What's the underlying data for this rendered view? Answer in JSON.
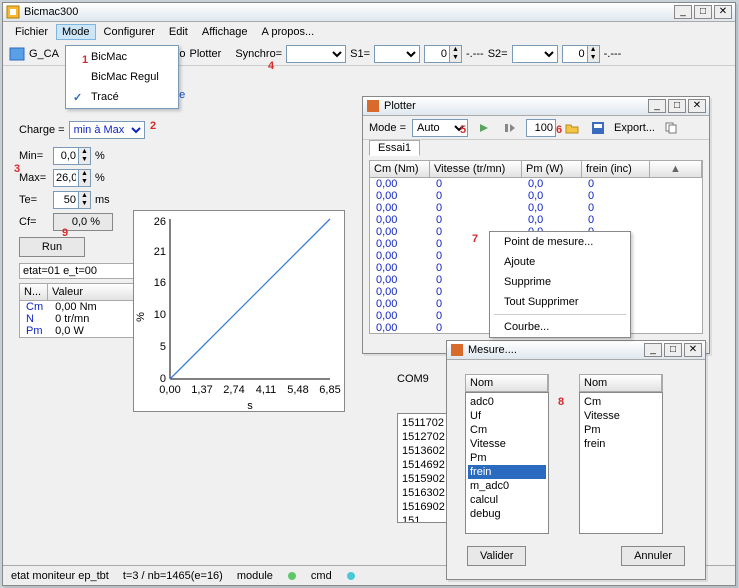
{
  "main_window": {
    "title": "Bicmac300",
    "menus": [
      "Fichier",
      "Mode",
      "Configurer",
      "Edit",
      "Affichage",
      "A propos..."
    ],
    "mode_submenu": {
      "items": [
        "BicMac",
        "BicMac Regul",
        "Tracé"
      ],
      "checked_index": 2
    },
    "toolbar": {
      "gca_prefix": "G_CA",
      "plotter_label": "Plotter",
      "synchro_label": "Synchro=",
      "s1_label": "S1=",
      "s2_label": "S2=",
      "spin_zero": "0",
      "link_ue": "ue"
    },
    "left_panel": {
      "charge_label": "Charge =",
      "charge_value": "min à Max",
      "min_label": "Min=",
      "min_value": "0,0",
      "pct": "%",
      "max_label": "Max=",
      "max_value": "26,0",
      "te_label": "Te=",
      "te_value": "50",
      "te_unit": "ms",
      "cf_label": "Cf=",
      "cf_value": "0,0 %",
      "run_label": "Run",
      "etat": "etat=01 e_t=00",
      "table_header_n": "N...",
      "table_header_val": "Valeur",
      "rows": [
        [
          "Cm",
          "0,00 Nm"
        ],
        [
          "N",
          "0 tr/mn"
        ],
        [
          "Pm",
          "0,0  W"
        ]
      ]
    }
  },
  "chart_data": {
    "type": "line",
    "title": "",
    "xlabel": "s",
    "ylabel": "%",
    "x": [
      0.0,
      6.85
    ],
    "values": [
      0,
      26
    ],
    "xticks": [
      "0,00",
      "1,37",
      "2,74",
      "4,11",
      "5,48",
      "6,85"
    ],
    "yticks": [
      "0",
      "5",
      "10",
      "16",
      "21",
      "26"
    ],
    "xlim": [
      0,
      6.85
    ],
    "ylim": [
      0,
      26
    ]
  },
  "plotter_window": {
    "title": "Plotter",
    "mode_label": "Mode =",
    "mode_value": "Auto",
    "hundred": "100",
    "export_label": "Export...",
    "tab": "Essai1",
    "columns": [
      "Cm (Nm)",
      "Vitesse (tr/mn)",
      "Pm (W)",
      "frein (inc)"
    ],
    "row": [
      "0,00",
      "0",
      "0,0",
      "0"
    ],
    "row_count": 13,
    "context_menu": [
      "Point de mesure...",
      "Ajoute",
      "Supprime",
      "Tout Supprimer",
      "Courbe..."
    ]
  },
  "mesure_window": {
    "title": "Mesure....",
    "col_label": "Nom",
    "left_list": [
      "adc0",
      "Uf",
      "Cm",
      "Vitesse",
      "Pm",
      "frein",
      "m_adc0",
      "calcul",
      "debug"
    ],
    "left_selected_index": 5,
    "right_list": [
      "Cm",
      "Vitesse",
      "Pm",
      "frein"
    ],
    "valider": "Valider",
    "annuler": "Annuler"
  },
  "log_panel": {
    "com": "COM9",
    "lines": [
      "1511702",
      "1512702",
      "1513602",
      "1514692",
      "1515902",
      "1516302",
      "1516902",
      "151"
    ]
  },
  "status_bar": {
    "left": "etat moniteur ep_tbt",
    "mid": "t=3 / nb=1465(e=16)",
    "module": "module",
    "cmd": "cmd"
  },
  "annotations": {
    "1": "1",
    "2": "2",
    "3": "3",
    "4": "4",
    "5": "5",
    "6": "6",
    "7": "7",
    "8": "8",
    "9": "9"
  }
}
